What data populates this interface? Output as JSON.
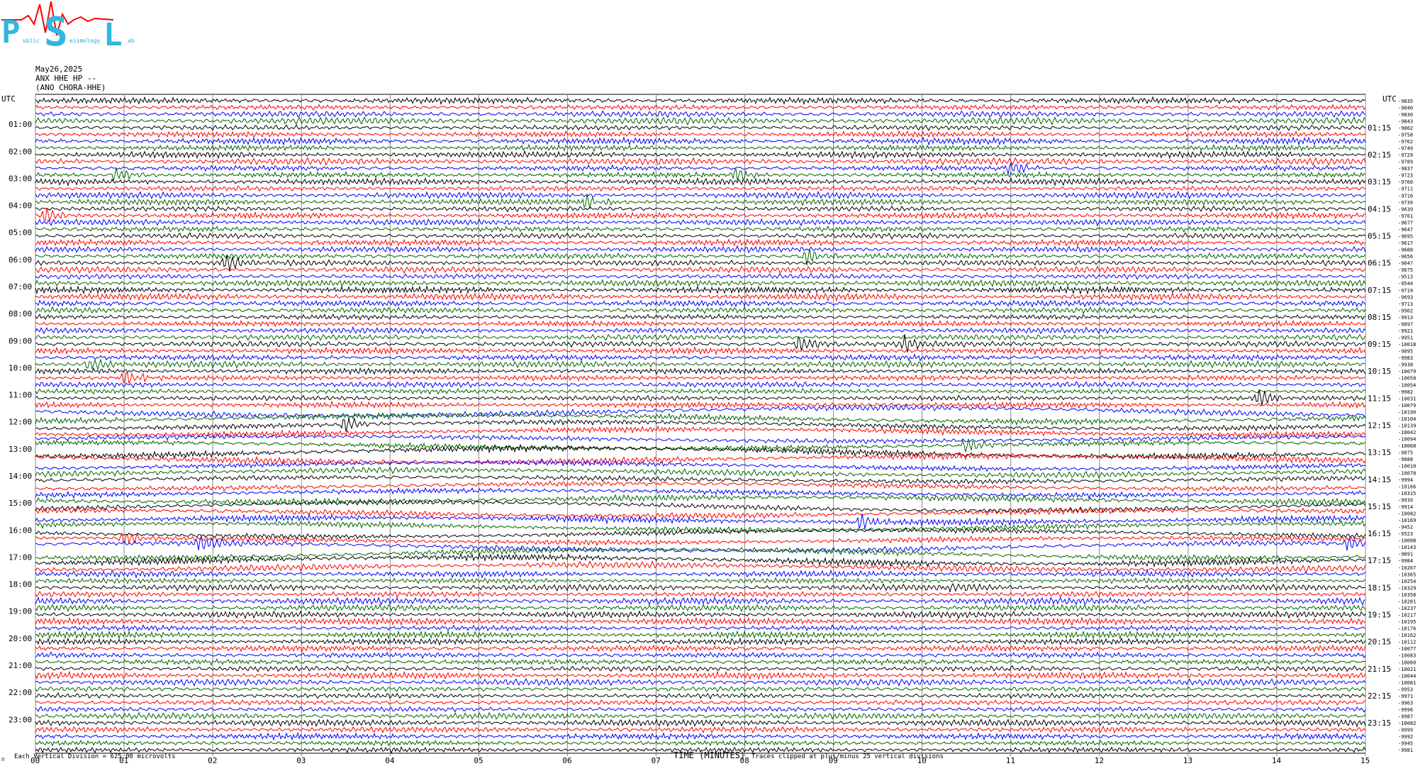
{
  "logo": {
    "letters": [
      "P",
      "S",
      "L"
    ],
    "small_words": [
      "ublic",
      "eismology",
      "ab"
    ],
    "colors": {
      "main": "#2fb8e0",
      "trace": "#ff0000",
      "word": "#2aa8d0"
    }
  },
  "header": {
    "date": "May26,2025",
    "channel": "ANX HHE HP --",
    "station": "(ANO CHORA-HHE)"
  },
  "footer": {
    "scale": "Each Vertical Division =  625.00 microvolts",
    "xlabel": "TIME (MINUTES)",
    "clip_note": "Traces clipped at plus/minus 25 vertical divisions",
    "corner_mark": "∩"
  },
  "chart_data": {
    "type": "line",
    "title": "",
    "xlabel": "TIME (MINUTES)",
    "x_ticks": [
      "00",
      "01",
      "02",
      "03",
      "04",
      "05",
      "06",
      "07",
      "08",
      "09",
      "10",
      "11",
      "12",
      "13",
      "14",
      "15"
    ],
    "xlim": [
      0,
      15
    ],
    "grid": true,
    "trace_colors": [
      "#000000",
      "#ff0000",
      "#0000ff",
      "#006400"
    ],
    "left_axis_title": "UTC",
    "right_axis_title": "UTC",
    "left_hour_labels": [
      "01:00",
      "02:00",
      "03:00",
      "04:00",
      "05:00",
      "06:00",
      "07:00",
      "08:00",
      "09:00",
      "10:00",
      "11:00",
      "12:00",
      "13:00",
      "14:00",
      "15:00",
      "16:00",
      "17:00",
      "18:00",
      "19:00",
      "20:00",
      "21:00",
      "22:00",
      "23:00"
    ],
    "right_hour_labels": [
      "01:15",
      "02:15",
      "03:15",
      "04:15",
      "05:15",
      "06:15",
      "07:15",
      "08:15",
      "09:15",
      "10:15",
      "11:15",
      "12:15",
      "13:15",
      "14:15",
      "15:15",
      "16:15",
      "17:15",
      "18:15",
      "19:15",
      "20:15",
      "21:15",
      "22:15",
      "23:15"
    ],
    "trace_offsets": [
      "-9835",
      "-9840",
      "-9830",
      "-9843",
      "-9862",
      "-9758",
      "-9762",
      "-9749",
      "-9729",
      "-9789",
      "-9837",
      "-9723",
      "-9760",
      "-9711",
      "-9716",
      "-9739",
      "-9639",
      "-9701",
      "-9677",
      "-9647",
      "-9695",
      "-9617",
      "-9688",
      "-9656",
      "-9647",
      "-9675",
      "-9513",
      "-9544",
      "-9719",
      "-9693",
      "-9713",
      "-9902",
      "-9913",
      "-9897",
      "-9921",
      "-9951",
      "-10018",
      "-9895",
      "-9983",
      "-9938",
      "-10079",
      "-10058",
      "-10054",
      "-9982",
      "-10031",
      "-10079",
      "-10190",
      "-10104",
      "-10139",
      "-10042",
      "-10094",
      "-10068",
      "-9875",
      "-9888",
      "-10010",
      "-10078",
      "-9994",
      "-10166",
      "-10315",
      "-9939",
      "-9914",
      "-10082",
      "-10169",
      "-9452",
      "-9523",
      "-10008",
      "-10143",
      "-9891",
      "-9984",
      "-10267",
      "-10365",
      "-10254",
      "-10329",
      "-10358",
      "-10281",
      "-10237",
      "-10217",
      "-10195",
      "-10176",
      "-10162",
      "-10112",
      "-10077",
      "-10083",
      "-10060",
      "-10021",
      "-10044",
      "-10081",
      "-9953",
      "-9971",
      "-9963",
      "-9996",
      "-9987",
      "-10082",
      "-9999",
      "-9992",
      "-9945",
      "-9981"
    ],
    "event_marks": [
      {
        "trace": 10,
        "minute": 11.0,
        "color": "#ff0000"
      },
      {
        "trace": 11,
        "minute": 0.9,
        "color": "#0000ff"
      },
      {
        "trace": 11,
        "minute": 7.9,
        "color": "#0000ff"
      },
      {
        "trace": 15,
        "minute": 6.2,
        "color": "#006400"
      },
      {
        "trace": 17,
        "minute": 0.1,
        "color": "#0000ff"
      },
      {
        "trace": 24,
        "minute": 2.15,
        "color": "#000000"
      },
      {
        "trace": 23,
        "minute": 8.7,
        "color": "#006400"
      },
      {
        "trace": 36,
        "minute": 9.8,
        "color": "#ff0000"
      },
      {
        "trace": 36,
        "minute": 8.6,
        "color": "#ff0000"
      },
      {
        "trace": 39,
        "minute": 0.6,
        "color": "#006400"
      },
      {
        "trace": 41,
        "minute": 1.0,
        "color": "#ff0000"
      },
      {
        "trace": 44,
        "minute": 13.8,
        "color": "#000000"
      },
      {
        "trace": 48,
        "minute": 3.5,
        "color": "#000000"
      },
      {
        "trace": 51,
        "minute": 10.5,
        "color": "#006400"
      },
      {
        "trace": 62,
        "minute": 9.3,
        "color": "#0000ff"
      },
      {
        "trace": 65,
        "minute": 1.0,
        "color": "#ff0000"
      },
      {
        "trace": 66,
        "minute": 1.85,
        "color": "#0000ff"
      },
      {
        "trace": 66,
        "minute": 14.8,
        "color": "#0000ff"
      },
      {
        "trace": 72,
        "minute": 10.3,
        "color": "#000000"
      }
    ]
  }
}
